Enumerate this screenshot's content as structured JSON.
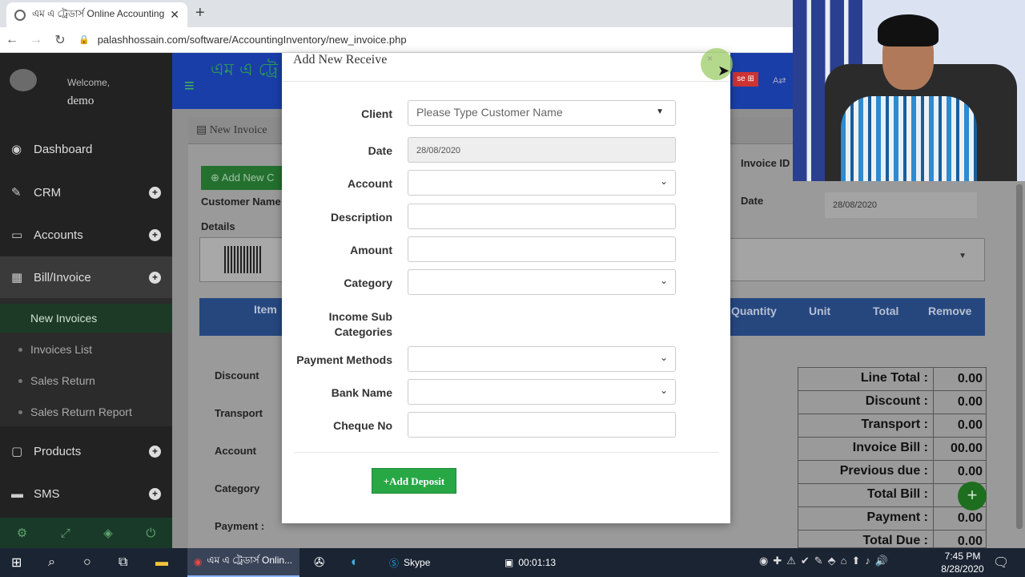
{
  "browser": {
    "tab_title": "এম এ ট্রেডার্স Online Accounting",
    "tab_close": "✕",
    "new_tab": "+",
    "url": "palashhossain.com/software/AccountingInventory/new_invoice.php"
  },
  "sidebar": {
    "welcome": "Welcome,",
    "username": "demo",
    "items": [
      {
        "label": "Dashboard",
        "icon": "◉"
      },
      {
        "label": "CRM",
        "icon": "✎"
      },
      {
        "label": "Accounts",
        "icon": "▭"
      },
      {
        "label": "Bill/Invoice",
        "icon": "▦"
      },
      {
        "label": "Products",
        "icon": "▢"
      },
      {
        "label": "SMS",
        "icon": "▬"
      }
    ],
    "submenu": [
      "New Invoices",
      "Invoices List",
      "Sales Return",
      "Sales Return Report"
    ],
    "footer_icons": [
      "⚙",
      "⤢",
      "◈",
      "⏻"
    ]
  },
  "app": {
    "brand": "এম এ ট্রে",
    "panel_title": "New Invoice",
    "add_new_btn": "Add New C",
    "customer_name_label": "Customer Name",
    "details_label": "Details",
    "invoice_id_label": "Invoice ID",
    "date_label": "Date",
    "date_value": "28/08/2020",
    "right_btn": "se ⊞",
    "table_headers": [
      "Item",
      "Quantity",
      "Unit",
      "Total",
      "Remove"
    ],
    "left_labels": [
      "Discount",
      "Transport",
      "Account",
      "Category",
      "Payment :"
    ],
    "totals": [
      {
        "label": "Line Total :",
        "value": "0.00"
      },
      {
        "label": "Discount :",
        "value": "0.00"
      },
      {
        "label": "Transport :",
        "value": "0.00"
      },
      {
        "label": "Invoice Bill :",
        "value": "00.00"
      },
      {
        "label": "Previous due :",
        "value": "0.00"
      },
      {
        "label": "Total Bill :",
        "value": ""
      },
      {
        "label": "Payment :",
        "value": "0.00"
      },
      {
        "label": "Total Due :",
        "value": "0.00"
      }
    ]
  },
  "modal": {
    "title": "Add New Receive",
    "close": "×",
    "fields": {
      "client_label": "Client",
      "client_placeholder": "Please Type Customer Name",
      "date_label": "Date",
      "date_value": "28/08/2020",
      "account_label": "Account",
      "description_label": "Description",
      "amount_label": "Amount",
      "category_label": "Category",
      "income_sub_label_1": "Income Sub",
      "income_sub_label_2": "Categories",
      "payment_methods_label": "Payment Methods",
      "bank_name_label": "Bank Name",
      "cheque_no_label": "Cheque No"
    },
    "submit": "+Add Deposit"
  },
  "taskbar": {
    "browser_item": "এম এ ট্রেডার্স Onlin...",
    "skype": "Skype",
    "recorder_time": "00:01:13",
    "time": "7:45 PM",
    "date": "8/28/2020"
  },
  "colors": {
    "sidebar_bg": "#222222",
    "appbar": "#1a3ea8",
    "accent_green": "#28a745",
    "table_head": "#26477e"
  }
}
